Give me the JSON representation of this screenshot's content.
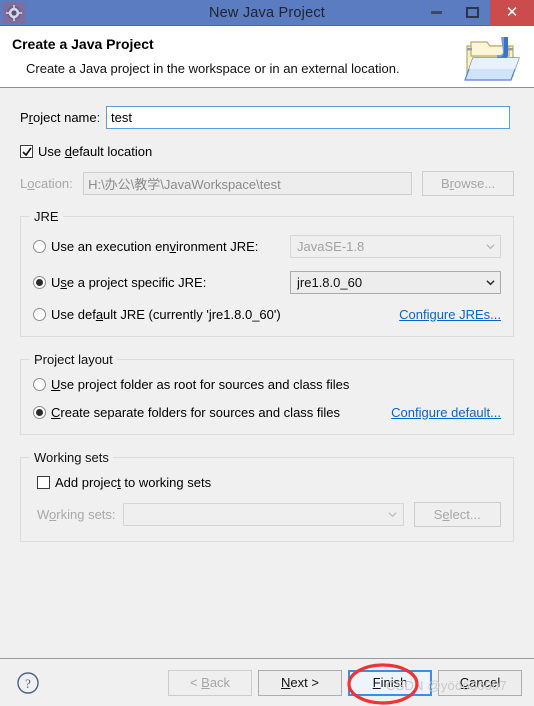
{
  "window": {
    "title": "New Java Project",
    "icon": "gear-icon",
    "controls": {
      "minimize": "–",
      "maximize": "□",
      "close": "✕"
    }
  },
  "header": {
    "title": "Create a Java Project",
    "description": "Create a Java project in the workspace or in an external location.",
    "icon": "java-project-folder-icon"
  },
  "project_name": {
    "label_pre": "P",
    "label_accel": "r",
    "label_post": "oject name:",
    "value": "test",
    "placeholder": ""
  },
  "location": {
    "use_default": {
      "label_pre": "Use ",
      "label_accel": "d",
      "label_post": "efault location",
      "checked": true,
      "tick": "✓"
    },
    "label_pre": "L",
    "label_accel": "o",
    "label_post": "cation:",
    "value": "H:\\办公\\教学\\JavaWorkspace\\test",
    "browse_pre": "B",
    "browse_accel": "r",
    "browse_post": "owse...",
    "enabled": false
  },
  "jre": {
    "group_title": "JRE",
    "options": [
      {
        "label_pre": "Use an execution en",
        "label_accel": "v",
        "label_post": "ironment JRE:",
        "selected": false,
        "combo_value": "JavaSE-1.8",
        "combo_enabled": false
      },
      {
        "label_pre": "U",
        "label_accel": "s",
        "label_post": "e a project specific JRE:",
        "selected": true,
        "combo_value": "jre1.8.0_60",
        "combo_enabled": true
      },
      {
        "label_pre": "Use def",
        "label_accel": "a",
        "label_post": "ult JRE (currently 'jre1.8.0_60')",
        "selected": false
      }
    ],
    "configure_link": "Configure JREs..."
  },
  "project_layout": {
    "group_title": "Project layout",
    "options": [
      {
        "label_pre": "",
        "label_accel": "U",
        "label_post": "se project folder as root for sources and class files",
        "selected": false
      },
      {
        "label_pre": "",
        "label_accel": "C",
        "label_post": "reate separate folders for sources and class files",
        "selected": true
      }
    ],
    "configure_link": "Configure default..."
  },
  "working_sets": {
    "group_title": "Working sets",
    "add_checkbox": {
      "label_pre": "Add projec",
      "label_accel": "t",
      "label_post": " to working sets",
      "checked": false
    },
    "label_pre": "W",
    "label_accel": "o",
    "label_post": "rking sets:",
    "combo_value": "",
    "select_pre": "S",
    "select_accel": "e",
    "select_post": "lect...",
    "enabled": false
  },
  "footer": {
    "help_icon": "help-question-icon",
    "buttons": [
      {
        "name": "back",
        "pre": "< ",
        "accel": "B",
        "post": "ack",
        "enabled": false,
        "focused": false
      },
      {
        "name": "next",
        "pre": "",
        "accel": "N",
        "post": "ext >",
        "enabled": true,
        "focused": false
      },
      {
        "name": "finish",
        "pre": "",
        "accel": "F",
        "post": "inish",
        "enabled": true,
        "focused": true
      },
      {
        "name": "cancel",
        "pre": "",
        "accel": "C",
        "post": "ancel",
        "enabled": true,
        "focused": false
      }
    ]
  },
  "annotations": {
    "highlight_target": "finish-button",
    "highlight_color": "#f03434",
    "watermark": "CSDN @yööööö007"
  },
  "colors": {
    "titlebar": "#5b7cc0",
    "close_button": "#cb4c4c",
    "body": "#f0f0f0",
    "link": "#0a64c8",
    "focus_border": "#3c8ede"
  }
}
